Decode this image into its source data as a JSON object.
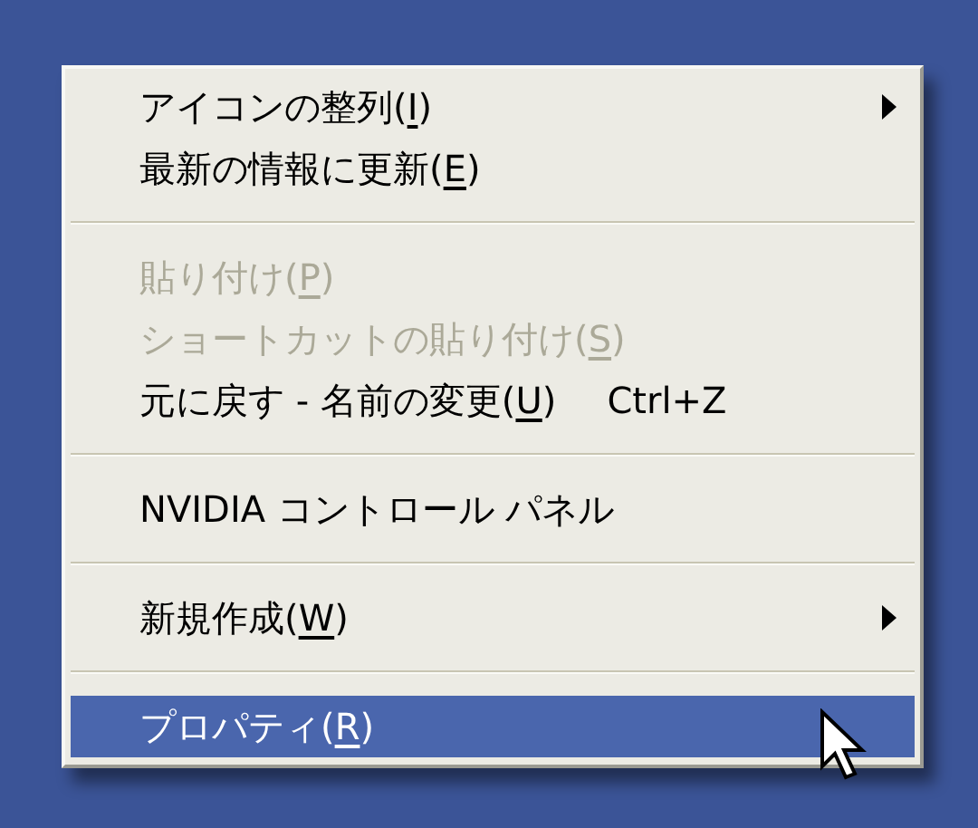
{
  "context_menu": {
    "items": [
      {
        "kind": "item",
        "text": "アイコンの整列(",
        "key": "I",
        "tail": ")",
        "disabled": false,
        "selected": false,
        "submenu": true
      },
      {
        "kind": "item",
        "text": "最新の情報に更新(",
        "key": "E",
        "tail": ")",
        "disabled": false,
        "selected": false,
        "submenu": false
      },
      {
        "kind": "separator"
      },
      {
        "kind": "item",
        "text": "貼り付け(",
        "key": "P",
        "tail": ")",
        "disabled": true,
        "selected": false,
        "submenu": false
      },
      {
        "kind": "item",
        "text": "ショートカットの貼り付け(",
        "key": "S",
        "tail": ")",
        "disabled": true,
        "selected": false,
        "submenu": false
      },
      {
        "kind": "item",
        "text": "元に戻す - 名前の変更(",
        "key": "U",
        "tail": ")",
        "shortcut": "Ctrl+Z",
        "disabled": false,
        "selected": false,
        "submenu": false
      },
      {
        "kind": "separator"
      },
      {
        "kind": "item",
        "text": "NVIDIA コントロール パネル",
        "disabled": false,
        "selected": false,
        "submenu": false
      },
      {
        "kind": "separator"
      },
      {
        "kind": "item",
        "text": "新規作成(",
        "key": "W",
        "tail": ")",
        "disabled": false,
        "selected": false,
        "submenu": true
      },
      {
        "kind": "separator"
      },
      {
        "kind": "item",
        "text": "プロパティ(",
        "key": "R",
        "tail": ")",
        "disabled": false,
        "selected": true,
        "submenu": false
      }
    ]
  }
}
